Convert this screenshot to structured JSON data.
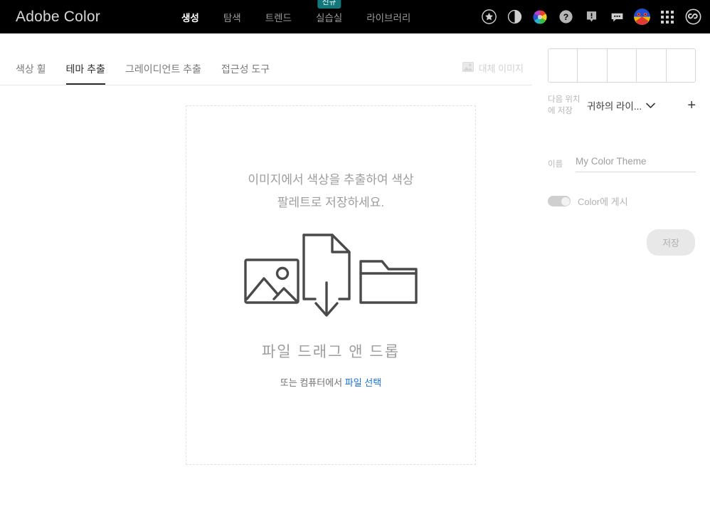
{
  "topbar": {
    "brand": "Adobe Color",
    "nav": [
      {
        "label": "생성",
        "active": true,
        "badge": null
      },
      {
        "label": "탐색",
        "active": false,
        "badge": null
      },
      {
        "label": "트렌드",
        "active": false,
        "badge": null
      },
      {
        "label": "실습실",
        "active": false,
        "badge": "신규"
      },
      {
        "label": "라이브러리",
        "active": false,
        "badge": null
      }
    ],
    "icons": [
      "star-icon",
      "contrast-icon",
      "color-wheel-icon",
      "help-icon",
      "notifications-icon",
      "feedback-icon",
      "avatar",
      "app-grid-icon",
      "creative-cloud-icon"
    ],
    "background": "#000000",
    "badge_color": "#12787c"
  },
  "subtabs": {
    "tabs": [
      {
        "label": "색상 휠",
        "active": false
      },
      {
        "label": "테마 추출",
        "active": true
      },
      {
        "label": "그레이디언트 추출",
        "active": false
      },
      {
        "label": "접근성 도구",
        "active": false
      }
    ],
    "replace_image": {
      "label": "대체 이미지",
      "icon": "image-icon",
      "disabled": true
    }
  },
  "dropzone": {
    "title": "이미지에서 색상을 추출하여 색상 팔레트로 저장하세요.",
    "drag_text": "파일 드래그 앤 드롭",
    "or_prefix": "또는 컴퓨터에서 ",
    "select_link": "파일 선택",
    "link_color": "#1473e6",
    "illustration": [
      "image-icon",
      "document-download-icon",
      "folder-icon"
    ]
  },
  "sidebar": {
    "swatches": [
      "#ffffff",
      "#ffffff",
      "#ffffff",
      "#ffffff",
      "#ffffff"
    ],
    "save_to_label": "다음 위치에 저장",
    "library_value": "귀하의 라이...",
    "add_library_label": "+",
    "name_label": "이름",
    "name_placeholder": "My Color Theme",
    "name_value": "",
    "publish_label": "Color에 게시",
    "publish_on": false,
    "save_button": "저장",
    "save_button_disabled": true
  }
}
